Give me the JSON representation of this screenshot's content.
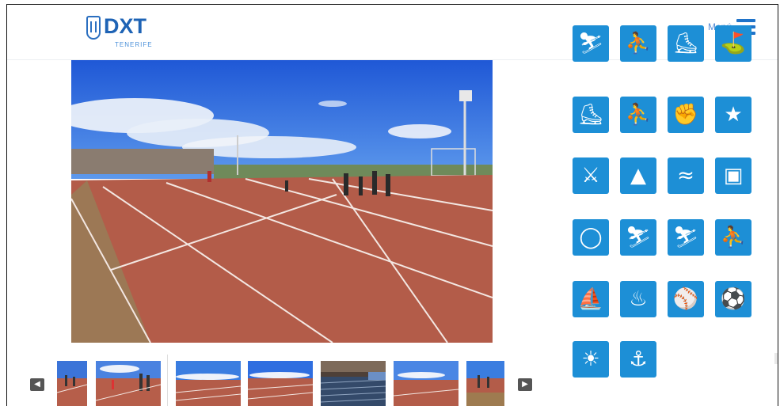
{
  "header": {
    "logo_text": "DXT",
    "logo_subtitle": "TENERIFE",
    "menu_label": "Menú"
  },
  "gallery": {
    "prev_icon": "chevron-left-icon",
    "next_icon": "chevron-right-icon",
    "thumbnails": [
      {
        "scene": "track-people"
      },
      {
        "scene": "track-people"
      },
      {
        "scene": "track-wide"
      },
      {
        "scene": "track-wide"
      },
      {
        "scene": "stands"
      },
      {
        "scene": "track-wide"
      },
      {
        "scene": "track-people"
      }
    ]
  },
  "sports": [
    {
      "name": "",
      "icon": "sport-icon"
    },
    {
      "name": "",
      "icon": "sport-icon"
    },
    {
      "name": "",
      "icon": "sport-icon"
    },
    {
      "name": "",
      "icon": "sport-icon"
    },
    {
      "name": "",
      "icon": "cycling-icon"
    },
    {
      "name": "",
      "icon": "running-icon"
    },
    {
      "name": "",
      "icon": "martial-arts-icon"
    },
    {
      "name": "",
      "icon": "gymnastics-icon"
    },
    {
      "name": "",
      "icon": "fencing-icon"
    },
    {
      "name": "",
      "icon": "climbing-icon"
    },
    {
      "name": "",
      "icon": "swimming-icon"
    },
    {
      "name": "",
      "icon": "table-icon"
    },
    {
      "name": "",
      "icon": "orienteering-icon"
    },
    {
      "name": "",
      "icon": "skating-icon"
    },
    {
      "name": "",
      "icon": "skating-icon"
    },
    {
      "name": "",
      "icon": "rugby-icon"
    },
    {
      "name": "",
      "icon": "sailing-icon"
    },
    {
      "name": "",
      "icon": "dance-icon"
    },
    {
      "name": "",
      "icon": "tennis-icon"
    },
    {
      "name": "",
      "icon": "volleyball-icon"
    },
    {
      "name": "",
      "icon": "beach-volleyball-icon"
    },
    {
      "name": "",
      "icon": "water-sport-icon"
    }
  ],
  "colors": {
    "brand": "#1e63b5",
    "tile": "#1d8fd6",
    "track": "#b85f4c",
    "sky": "#2a6ee0"
  }
}
